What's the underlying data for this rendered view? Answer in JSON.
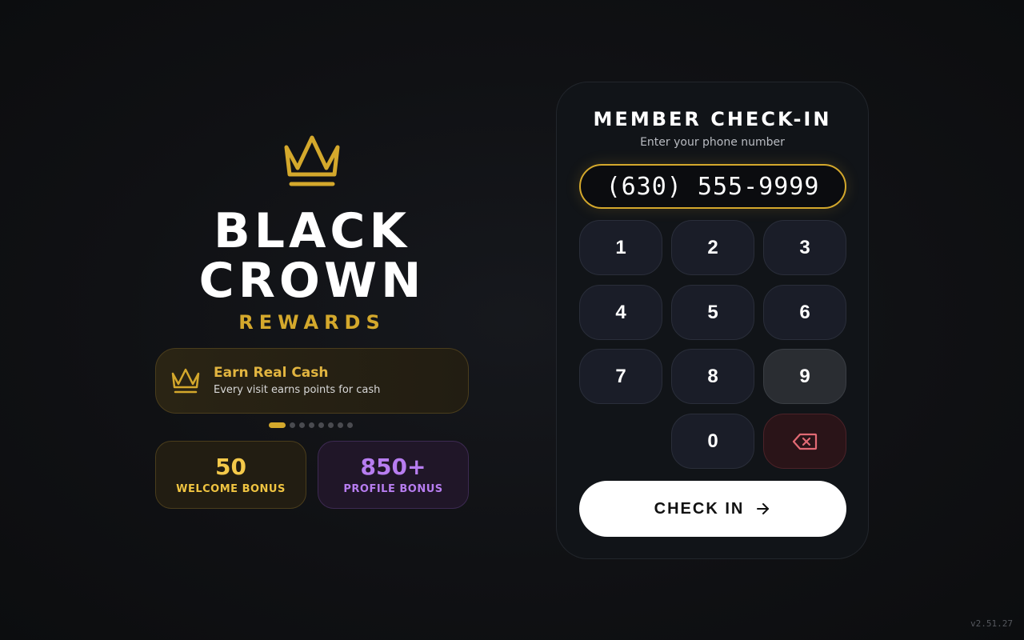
{
  "brand": {
    "line1": "BLACK",
    "line2": "CROWN",
    "subtitle": "REWARDS",
    "logo_icon": "crown-icon",
    "accent_color": "#d4a82c"
  },
  "promo": {
    "icon": "crown-icon",
    "title": "Earn Real Cash",
    "description": "Every visit earns points for cash"
  },
  "carousel": {
    "total_slides": 8,
    "active_index": 0
  },
  "bonuses": [
    {
      "value": "50",
      "label": "WELCOME BONUS",
      "color": "#f4c94a"
    },
    {
      "value": "850+",
      "label": "PROFILE BONUS",
      "color": "#b77df0"
    }
  ],
  "checkin_panel": {
    "title": "MEMBER CHECK-IN",
    "subtitle": "Enter your phone number",
    "phone_value": "(630) 555-9999",
    "keys": [
      "1",
      "2",
      "3",
      "4",
      "5",
      "6",
      "7",
      "8",
      "9",
      "0"
    ],
    "pressed_key": "9",
    "backspace_icon": "backspace-icon",
    "submit_label": "CHECK IN",
    "submit_icon": "arrow-right-icon"
  },
  "version": "v2.51.27"
}
